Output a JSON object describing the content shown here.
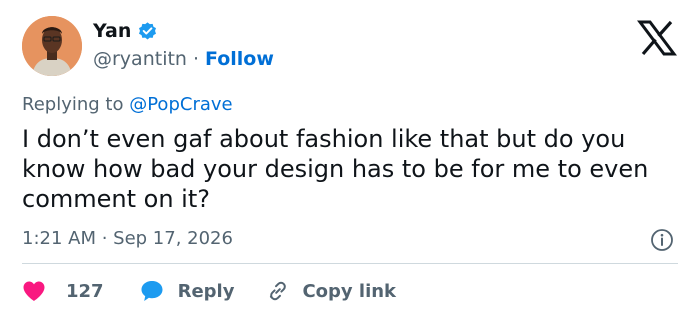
{
  "author": {
    "name": "Yan",
    "handle": "@ryantitn",
    "separator": "·",
    "follow_label": "Follow",
    "verified": true
  },
  "reply": {
    "prefix": "Replying to",
    "mention": "@PopCrave"
  },
  "tweet": {
    "text": "I don’t even gaf about fashion like that but do you know how bad your design has to be for me to even comment on it?",
    "timestamp": "1:21 AM · Sep 17, 2026"
  },
  "actions": {
    "like_count": "127",
    "reply_label": "Reply",
    "copy_label": "Copy link"
  },
  "icons": {
    "verified": "verified-badge-icon",
    "logo": "x-logo-icon",
    "info": "info-icon",
    "like": "heart-icon",
    "reply": "speech-bubble-icon",
    "copy": "link-icon"
  },
  "colors": {
    "accent": "#006fd6",
    "verified": "#1d9bf0",
    "heart": "#f91880",
    "text": "#0f1419",
    "muted": "#536471",
    "avatar_bg": "#e6935f"
  }
}
